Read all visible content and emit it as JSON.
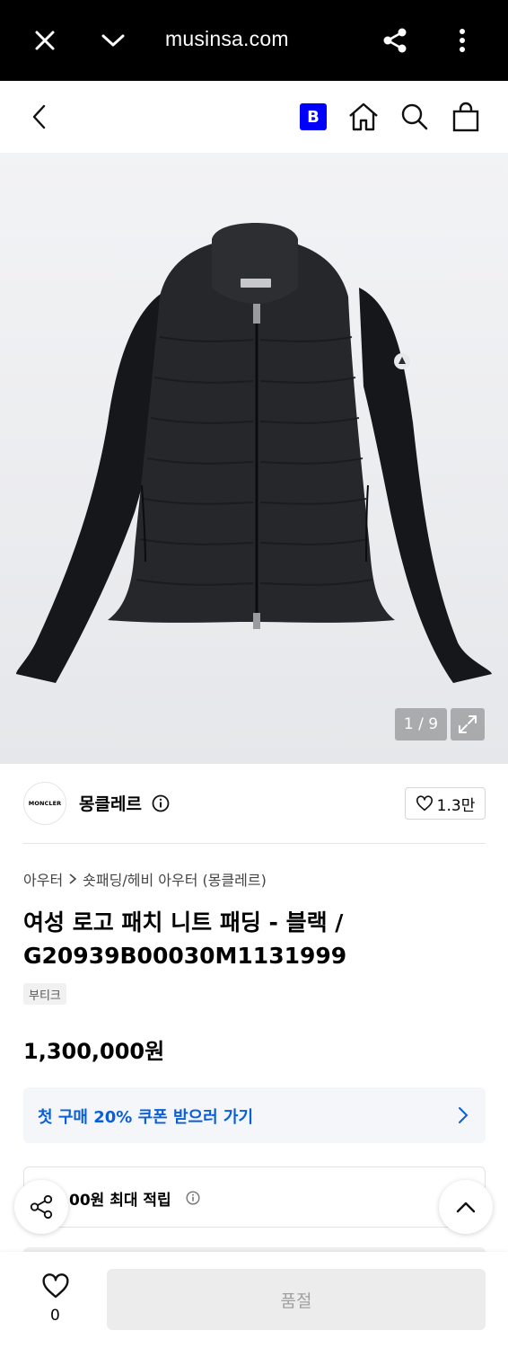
{
  "browser": {
    "url": "musinsa.com",
    "icons": [
      "close-icon",
      "chevron-down-icon",
      "share-icon",
      "more-vertical-icon"
    ]
  },
  "header": {
    "brand_badge": "B",
    "icons": [
      "back-icon",
      "home-icon",
      "search-icon",
      "shopping-bag-icon"
    ],
    "badge_color": "#0000ff"
  },
  "gallery": {
    "counter": "1 / 9",
    "current": 1,
    "total": 9,
    "garment_logo": "MONCLER"
  },
  "brand": {
    "logo_text": "MONCLER",
    "name": "몽클레르",
    "likes": "1.3만"
  },
  "breadcrumb": {
    "category": "아우터",
    "subcategory": "숏패딩/헤비 아우터 (몽클레르)"
  },
  "product": {
    "title": "여성 로고 패치 니트 패딩 - 블랙 / G20939B00030M1131999",
    "tag": "부티크",
    "price": "1,300,000원"
  },
  "coupon": {
    "text": "첫 구매 20% 쿠폰 받으러 가기",
    "color": "#0a5fd8"
  },
  "points": {
    "text": "00원 최대 적립"
  },
  "bottom_bar": {
    "heart_count": "0",
    "buy_label": "품절"
  }
}
